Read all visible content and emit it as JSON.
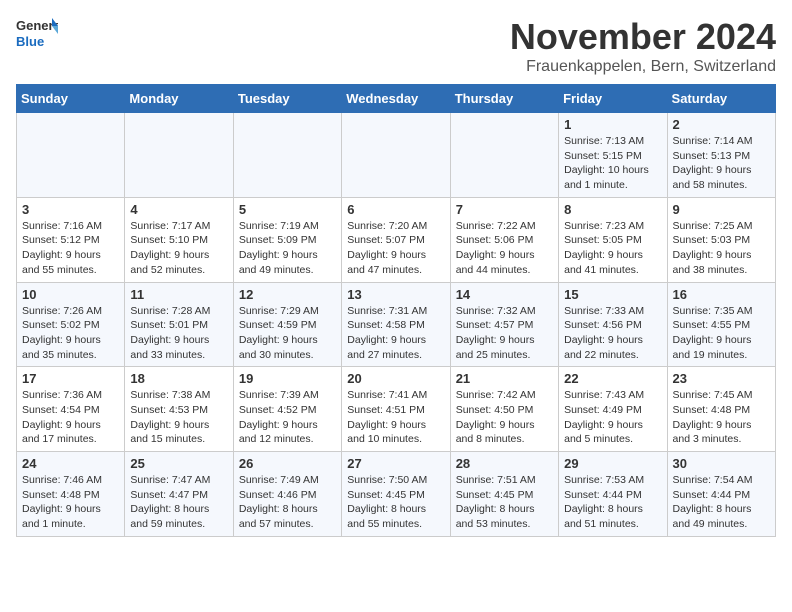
{
  "logo": {
    "general": "General",
    "blue": "Blue"
  },
  "title": {
    "month": "November 2024",
    "location": "Frauenkappelen, Bern, Switzerland"
  },
  "weekdays": [
    "Sunday",
    "Monday",
    "Tuesday",
    "Wednesday",
    "Thursday",
    "Friday",
    "Saturday"
  ],
  "weeks": [
    [
      {
        "day": "",
        "sunrise": "",
        "sunset": "",
        "daylight": ""
      },
      {
        "day": "",
        "sunrise": "",
        "sunset": "",
        "daylight": ""
      },
      {
        "day": "",
        "sunrise": "",
        "sunset": "",
        "daylight": ""
      },
      {
        "day": "",
        "sunrise": "",
        "sunset": "",
        "daylight": ""
      },
      {
        "day": "",
        "sunrise": "",
        "sunset": "",
        "daylight": ""
      },
      {
        "day": "1",
        "sunrise": "Sunrise: 7:13 AM",
        "sunset": "Sunset: 5:15 PM",
        "daylight": "Daylight: 10 hours and 1 minute."
      },
      {
        "day": "2",
        "sunrise": "Sunrise: 7:14 AM",
        "sunset": "Sunset: 5:13 PM",
        "daylight": "Daylight: 9 hours and 58 minutes."
      }
    ],
    [
      {
        "day": "3",
        "sunrise": "Sunrise: 7:16 AM",
        "sunset": "Sunset: 5:12 PM",
        "daylight": "Daylight: 9 hours and 55 minutes."
      },
      {
        "day": "4",
        "sunrise": "Sunrise: 7:17 AM",
        "sunset": "Sunset: 5:10 PM",
        "daylight": "Daylight: 9 hours and 52 minutes."
      },
      {
        "day": "5",
        "sunrise": "Sunrise: 7:19 AM",
        "sunset": "Sunset: 5:09 PM",
        "daylight": "Daylight: 9 hours and 49 minutes."
      },
      {
        "day": "6",
        "sunrise": "Sunrise: 7:20 AM",
        "sunset": "Sunset: 5:07 PM",
        "daylight": "Daylight: 9 hours and 47 minutes."
      },
      {
        "day": "7",
        "sunrise": "Sunrise: 7:22 AM",
        "sunset": "Sunset: 5:06 PM",
        "daylight": "Daylight: 9 hours and 44 minutes."
      },
      {
        "day": "8",
        "sunrise": "Sunrise: 7:23 AM",
        "sunset": "Sunset: 5:05 PM",
        "daylight": "Daylight: 9 hours and 41 minutes."
      },
      {
        "day": "9",
        "sunrise": "Sunrise: 7:25 AM",
        "sunset": "Sunset: 5:03 PM",
        "daylight": "Daylight: 9 hours and 38 minutes."
      }
    ],
    [
      {
        "day": "10",
        "sunrise": "Sunrise: 7:26 AM",
        "sunset": "Sunset: 5:02 PM",
        "daylight": "Daylight: 9 hours and 35 minutes."
      },
      {
        "day": "11",
        "sunrise": "Sunrise: 7:28 AM",
        "sunset": "Sunset: 5:01 PM",
        "daylight": "Daylight: 9 hours and 33 minutes."
      },
      {
        "day": "12",
        "sunrise": "Sunrise: 7:29 AM",
        "sunset": "Sunset: 4:59 PM",
        "daylight": "Daylight: 9 hours and 30 minutes."
      },
      {
        "day": "13",
        "sunrise": "Sunrise: 7:31 AM",
        "sunset": "Sunset: 4:58 PM",
        "daylight": "Daylight: 9 hours and 27 minutes."
      },
      {
        "day": "14",
        "sunrise": "Sunrise: 7:32 AM",
        "sunset": "Sunset: 4:57 PM",
        "daylight": "Daylight: 9 hours and 25 minutes."
      },
      {
        "day": "15",
        "sunrise": "Sunrise: 7:33 AM",
        "sunset": "Sunset: 4:56 PM",
        "daylight": "Daylight: 9 hours and 22 minutes."
      },
      {
        "day": "16",
        "sunrise": "Sunrise: 7:35 AM",
        "sunset": "Sunset: 4:55 PM",
        "daylight": "Daylight: 9 hours and 19 minutes."
      }
    ],
    [
      {
        "day": "17",
        "sunrise": "Sunrise: 7:36 AM",
        "sunset": "Sunset: 4:54 PM",
        "daylight": "Daylight: 9 hours and 17 minutes."
      },
      {
        "day": "18",
        "sunrise": "Sunrise: 7:38 AM",
        "sunset": "Sunset: 4:53 PM",
        "daylight": "Daylight: 9 hours and 15 minutes."
      },
      {
        "day": "19",
        "sunrise": "Sunrise: 7:39 AM",
        "sunset": "Sunset: 4:52 PM",
        "daylight": "Daylight: 9 hours and 12 minutes."
      },
      {
        "day": "20",
        "sunrise": "Sunrise: 7:41 AM",
        "sunset": "Sunset: 4:51 PM",
        "daylight": "Daylight: 9 hours and 10 minutes."
      },
      {
        "day": "21",
        "sunrise": "Sunrise: 7:42 AM",
        "sunset": "Sunset: 4:50 PM",
        "daylight": "Daylight: 9 hours and 8 minutes."
      },
      {
        "day": "22",
        "sunrise": "Sunrise: 7:43 AM",
        "sunset": "Sunset: 4:49 PM",
        "daylight": "Daylight: 9 hours and 5 minutes."
      },
      {
        "day": "23",
        "sunrise": "Sunrise: 7:45 AM",
        "sunset": "Sunset: 4:48 PM",
        "daylight": "Daylight: 9 hours and 3 minutes."
      }
    ],
    [
      {
        "day": "24",
        "sunrise": "Sunrise: 7:46 AM",
        "sunset": "Sunset: 4:48 PM",
        "daylight": "Daylight: 9 hours and 1 minute."
      },
      {
        "day": "25",
        "sunrise": "Sunrise: 7:47 AM",
        "sunset": "Sunset: 4:47 PM",
        "daylight": "Daylight: 8 hours and 59 minutes."
      },
      {
        "day": "26",
        "sunrise": "Sunrise: 7:49 AM",
        "sunset": "Sunset: 4:46 PM",
        "daylight": "Daylight: 8 hours and 57 minutes."
      },
      {
        "day": "27",
        "sunrise": "Sunrise: 7:50 AM",
        "sunset": "Sunset: 4:45 PM",
        "daylight": "Daylight: 8 hours and 55 minutes."
      },
      {
        "day": "28",
        "sunrise": "Sunrise: 7:51 AM",
        "sunset": "Sunset: 4:45 PM",
        "daylight": "Daylight: 8 hours and 53 minutes."
      },
      {
        "day": "29",
        "sunrise": "Sunrise: 7:53 AM",
        "sunset": "Sunset: 4:44 PM",
        "daylight": "Daylight: 8 hours and 51 minutes."
      },
      {
        "day": "30",
        "sunrise": "Sunrise: 7:54 AM",
        "sunset": "Sunset: 4:44 PM",
        "daylight": "Daylight: 8 hours and 49 minutes."
      }
    ]
  ]
}
